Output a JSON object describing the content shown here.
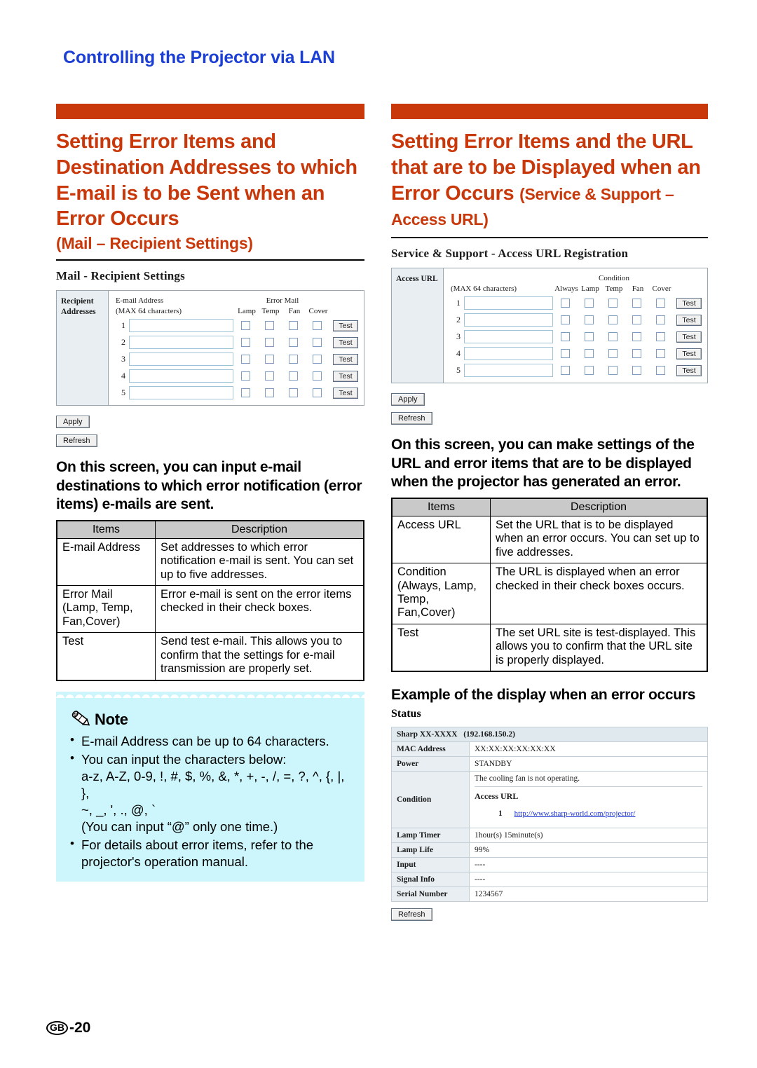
{
  "chapter_title": "Controlling the Projector via LAN",
  "footer": {
    "region": "GB",
    "page": "-20"
  },
  "colors": {
    "accent_orange": "#c9380b",
    "chapter_blue": "#1b3fd4",
    "note_bg": "#ccf6fb"
  },
  "left": {
    "heading_main": "Setting Error Items and Destination Addresses to which E-mail is to be Sent when an Error Occurs",
    "heading_sub": "(Mail – Recipient Settings)",
    "screenshot": {
      "title": "Mail - Recipient Settings",
      "row_label": "Recipient Addresses",
      "address_header": "E-mail Address",
      "address_hint": "(MAX 64 characters)",
      "group_title": "Error Mail",
      "checkbox_columns": [
        "Lamp",
        "Temp",
        "Fan",
        "Cover"
      ],
      "rows": [
        "1",
        "2",
        "3",
        "4",
        "5"
      ],
      "test_label": "Test",
      "apply_label": "Apply",
      "refresh_label": "Refresh"
    },
    "body": "On this screen, you can input e-mail destinations to which error notification (error items) e-mails are sent.",
    "table": {
      "headers": [
        "Items",
        "Description"
      ],
      "rows": [
        {
          "item": "E-mail Address",
          "desc": "Set addresses to which error notification e-mail is sent. You can set up to five addresses."
        },
        {
          "item": "Error Mail (Lamp, Temp, Fan,Cover)",
          "desc": "Error e-mail is sent on the error items checked in their check boxes."
        },
        {
          "item": "Test",
          "desc": "Send test e-mail. This allows you to confirm that the settings for e-mail transmission are properly set."
        }
      ]
    },
    "note": {
      "title": "Note",
      "icon": "pencil-icon",
      "items": [
        {
          "text": "E-mail Address can be up to 64 characters."
        },
        {
          "text": "You can input the characters below:",
          "lines": [
            "a-z, A-Z, 0-9, !, #, $, %, &, *, +, -, /, =, ?, ^, {, |, },",
            "~, _, ', ., @, `",
            "(You can input “@” only one time.)"
          ]
        },
        {
          "text": "For details about error items, refer to the projector's operation manual."
        }
      ]
    }
  },
  "right": {
    "heading_main": "Setting Error Items and the URL that are to be Displayed when an Error Occurs",
    "heading_sub": "(Service & Support – Access URL)",
    "screenshot": {
      "title": "Service & Support - Access URL Registration",
      "row_label": "Access URL",
      "address_hint": "(MAX 64 characters)",
      "group_title": "Condition",
      "checkbox_columns": [
        "Always",
        "Lamp",
        "Temp",
        "Fan",
        "Cover"
      ],
      "rows": [
        "1",
        "2",
        "3",
        "4",
        "5"
      ],
      "test_label": "Test",
      "apply_label": "Apply",
      "refresh_label": "Refresh"
    },
    "body": "On this screen, you can make settings of the URL and error items that are to be displayed when the projector has generated an error.",
    "table": {
      "headers": [
        "Items",
        "Description"
      ],
      "rows": [
        {
          "item": "Access URL",
          "desc": "Set the URL that is to be displayed when an error occurs. You can set up to five addresses."
        },
        {
          "item": "Condition (Always, Lamp, Temp, Fan,Cover)",
          "desc": "The URL is displayed when an error checked in their check boxes occurs."
        },
        {
          "item": "Test",
          "desc": "The set URL site is test-displayed. This allows you to confirm that the URL site is properly displayed."
        }
      ]
    },
    "example_heading": "Example of the display when an error occurs",
    "status": {
      "label": "Status",
      "device": "Sharp XX-XXXX",
      "ip": "(192.168.150.2)",
      "rows": [
        {
          "key": "MAC Address",
          "value": "XX:XX:XX:XX:XX:XX"
        },
        {
          "key": "Power",
          "value": "STANDBY"
        }
      ],
      "condition_key": "Condition",
      "condition_message": "The cooling fan is not operating.",
      "condition_url_title": "Access URL",
      "condition_url_index": "1",
      "condition_url": "http://www.sharp-world.com/projector/",
      "rows2": [
        {
          "key": "Lamp Timer",
          "value": "1hour(s) 15minute(s)"
        },
        {
          "key": "Lamp Life",
          "value": "99%"
        },
        {
          "key": "Input",
          "value": "----"
        },
        {
          "key": "Signal Info",
          "value": "----"
        },
        {
          "key": "Serial Number",
          "value": "1234567"
        }
      ],
      "refresh_label": "Refresh"
    }
  }
}
